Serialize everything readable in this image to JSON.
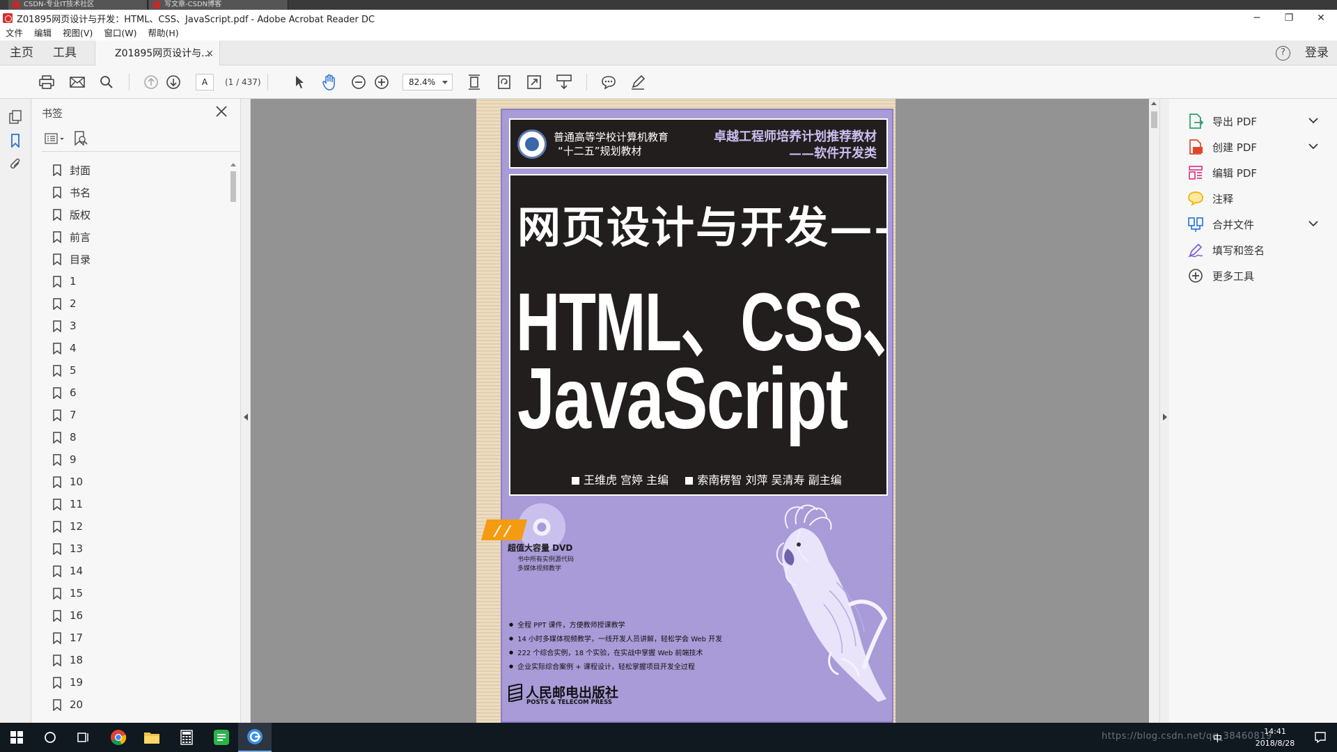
{
  "browser_tabs": [
    {
      "label": "CSDN-专业IT技术社区"
    },
    {
      "label": "写文章-CSDN博客"
    }
  ],
  "window": {
    "title": "Z01895网页设计与开发：HTML、CSS、JavaScript.pdf - Adobe Acrobat Reader DC",
    "minimize": "─",
    "maximize": "❐",
    "close": "✕"
  },
  "menu": [
    "文件",
    "编辑",
    "视图(V)",
    "窗口(W)",
    "帮助(H)"
  ],
  "tabs": {
    "home": "主页",
    "tools": "工具",
    "document": "Z01895网页设计与...",
    "document_close": "×",
    "help": "?",
    "login": "登录"
  },
  "toolbar": {
    "page_number": "A",
    "page_total": "(1 / 437)",
    "zoom": "82.4%"
  },
  "bookmarks": {
    "title": "书签",
    "items": [
      "封面",
      "书名",
      "版权",
      "前言",
      "目录",
      "1",
      "2",
      "3",
      "4",
      "5",
      "6",
      "7",
      "8",
      "9",
      "10",
      "11",
      "12",
      "13",
      "14",
      "15",
      "16",
      "17",
      "18",
      "19",
      "20"
    ]
  },
  "cover": {
    "series_line1": "普通高等学校计算机教育",
    "series_line2": "“十二五”规划教材",
    "series_right1": "卓越工程师培养计划推荐教材",
    "series_right2": "——软件开发类",
    "title_line1": "网页设计与开发——",
    "title_line2": "HTML、CSS、",
    "title_line3": "JavaScript",
    "author_main": "王维虎 宫婷  主编",
    "author_sub": "索南楞智 刘萍 吴清寿  副主编",
    "dvd_stripe": "/ /",
    "dvd_label": "超值大容量 DVD",
    "dvd_sub1": "书中所有实例源代码",
    "dvd_sub2": "多媒体视频教学",
    "features": [
      "全程 PPT 课件，方便教师授课教学",
      "14 小时多媒体视频教学，一线开发人员讲解，轻松学会 Web 开发",
      "222 个综合实例，18 个实验，在实战中掌握 Web 前端技术",
      "企业实际综合案例 + 课程设计，轻松掌握项目开发全过程"
    ],
    "publisher_cn": "人民邮电出版社",
    "publisher_en": "POSTS & TELECOM PRESS"
  },
  "tools_pane": [
    {
      "label": "导出 PDF",
      "icon": "export-pdf-icon",
      "expand": true,
      "color": "#2e9e6b"
    },
    {
      "label": "创建 PDF",
      "icon": "create-pdf-icon",
      "expand": true,
      "color": "#e0452b"
    },
    {
      "label": "编辑 PDF",
      "icon": "edit-pdf-icon",
      "expand": false,
      "color": "#d9398d"
    },
    {
      "label": "注释",
      "icon": "comment-icon",
      "expand": false,
      "color": "#f2b400"
    },
    {
      "label": "合并文件",
      "icon": "combine-files-icon",
      "expand": true,
      "color": "#2b7bd6"
    },
    {
      "label": "填写和签名",
      "icon": "fill-sign-icon",
      "expand": false,
      "color": "#7b5fd6"
    },
    {
      "label": "更多工具",
      "icon": "more-tools-icon",
      "expand": false,
      "color": "#444444"
    }
  ],
  "taskbar": {
    "clock_time": "14:41",
    "clock_date": "2018/8/28",
    "ime": "中",
    "watermark": "https://blog.csdn.net/qq_38460819"
  }
}
